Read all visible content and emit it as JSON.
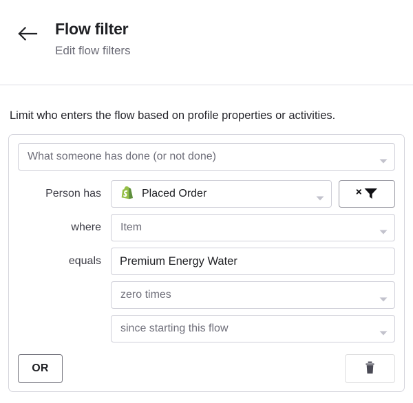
{
  "header": {
    "back_icon": "arrow-left-icon",
    "title": "Flow filter",
    "subtitle": "Edit flow filters"
  },
  "main": {
    "intro": "Limit who enters the flow based on profile properties or activities.",
    "filter_card": {
      "type_select": {
        "value": "What someone has done (or not done)",
        "caret_icon": "chevron-down-icon"
      },
      "rows": [
        {
          "label": "Person has",
          "value": "Placed Order",
          "icon": "shopify-icon",
          "caret_icon": "chevron-down-icon",
          "action_icon": "clear-filter-icon"
        },
        {
          "label": "where",
          "value": "Item",
          "caret_icon": "chevron-down-icon"
        },
        {
          "label": "equals",
          "value": "Premium Energy Water",
          "placeholder": "Enter value"
        }
      ],
      "extra_rows": [
        {
          "value": "zero times",
          "caret_icon": "chevron-down-icon"
        },
        {
          "value": "since starting this flow",
          "caret_icon": "chevron-down-icon"
        }
      ],
      "footer": {
        "or_label": "OR",
        "delete_icon": "trash-icon"
      }
    }
  },
  "colors": {
    "accent_green": "#95BF47",
    "accent_green_dark": "#5E8E3E",
    "text_primary": "#1f2024",
    "text_muted": "#6b6b76",
    "border": "#cfcfd8"
  }
}
